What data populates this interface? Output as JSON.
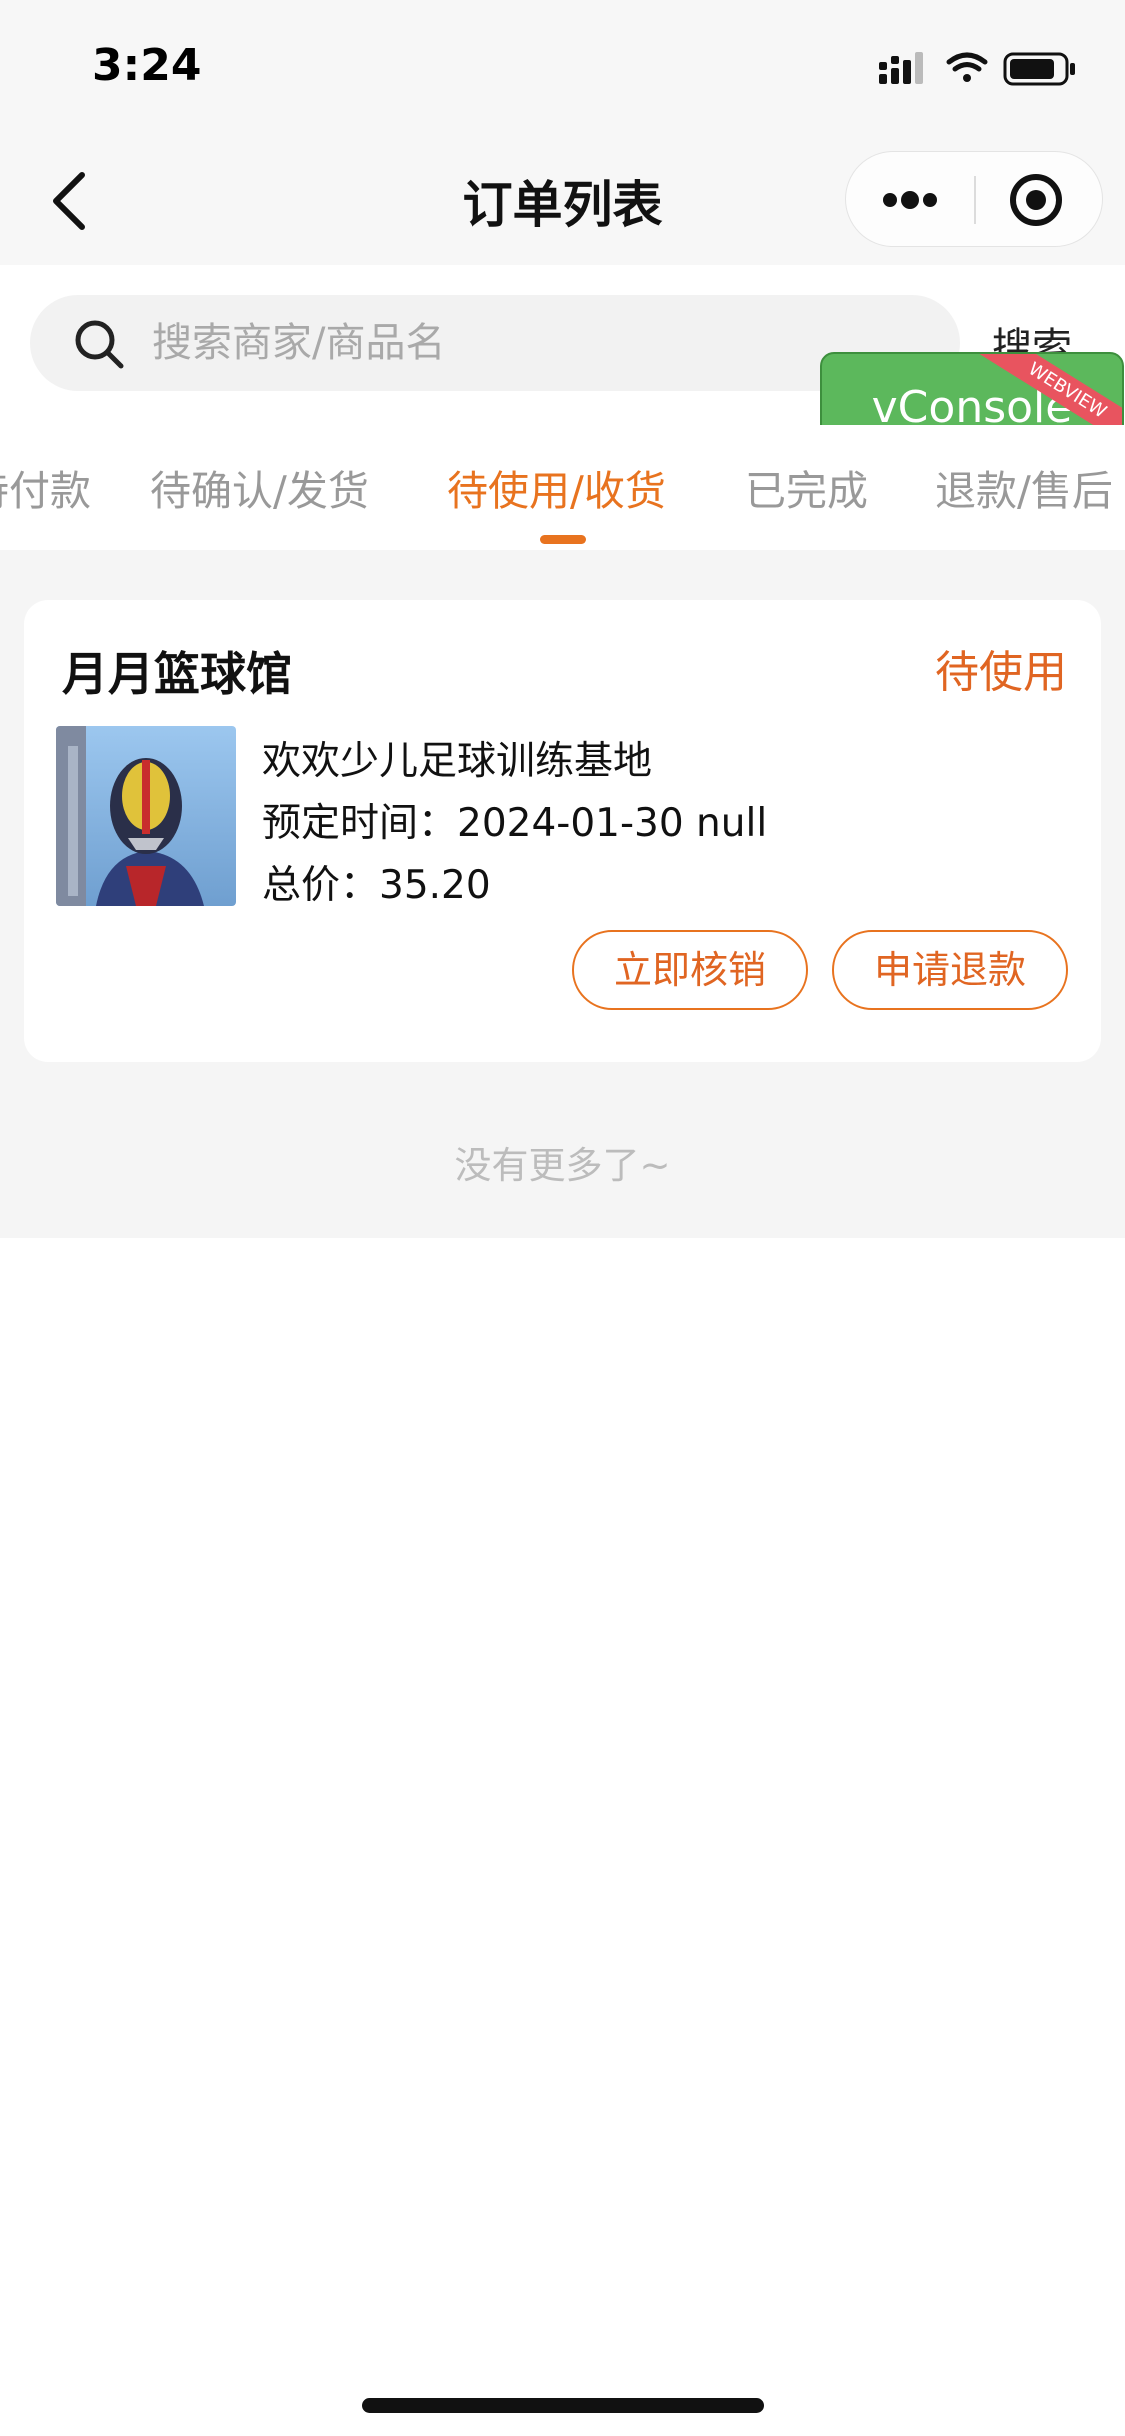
{
  "status_bar": {
    "time": "3:24"
  },
  "nav": {
    "title": "订单列表"
  },
  "search": {
    "placeholder": "搜索商家/商品名",
    "value": "",
    "button_label": "搜索"
  },
  "tabs": [
    {
      "label": "待付款"
    },
    {
      "label": "待确认/发货"
    },
    {
      "label": "待使用/收货",
      "active": true
    },
    {
      "label": "已完成"
    },
    {
      "label": "退款/售后"
    }
  ],
  "order": {
    "shop_name": "月月篮球馆",
    "status": "待使用",
    "item_name": "欢欢少儿足球训练基地",
    "reserve_time": "预定时间：2024-01-30 null",
    "total_price": "总价：35.20",
    "verify_button": "立即核销",
    "refund_button": "申请退款"
  },
  "list_end_text": "没有更多了~",
  "vconsole": {
    "label": "vConsole",
    "ribbon": "WEBVIEW"
  },
  "colors": {
    "accent": "#e8731f",
    "status_text": "#e06522",
    "vconsole_green": "#5cb85c"
  }
}
